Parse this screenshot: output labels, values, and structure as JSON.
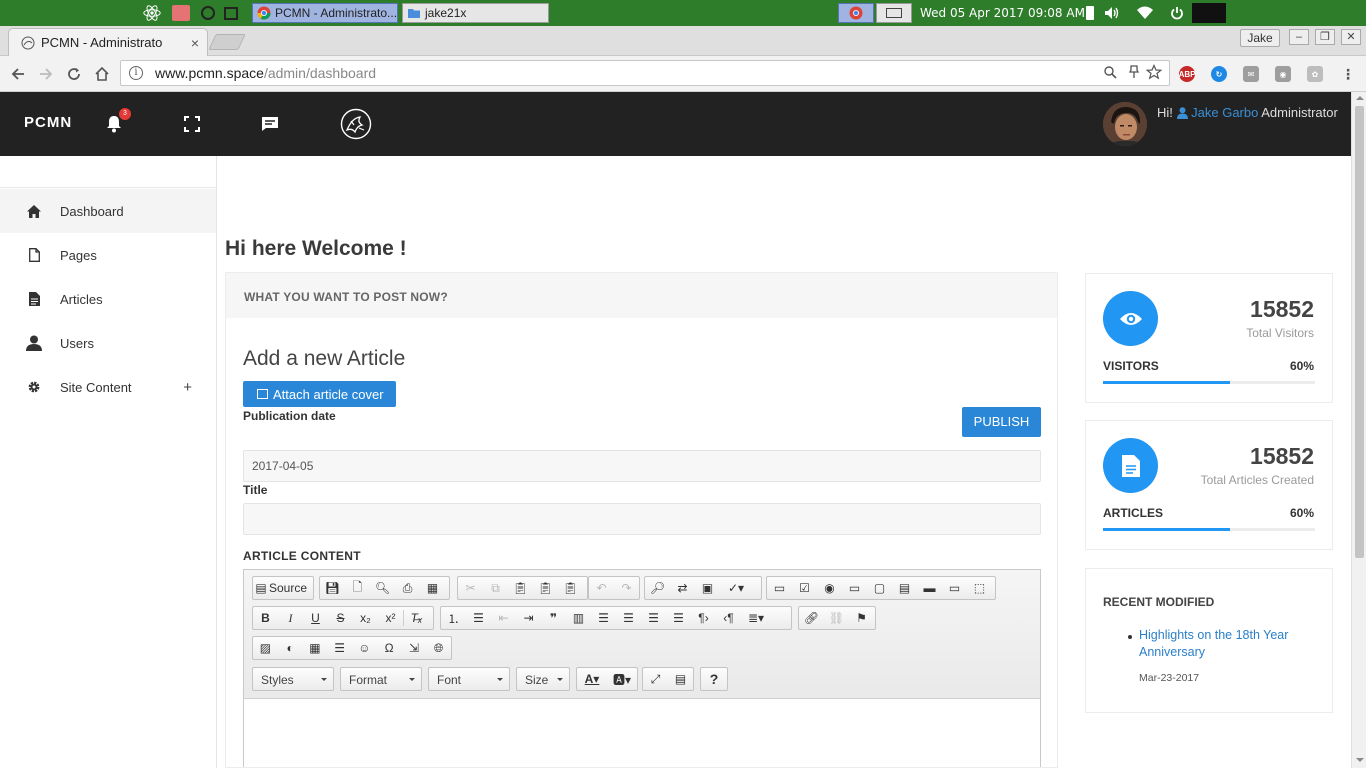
{
  "os": {
    "windows": [
      "PCMN - Administrato...",
      "jake21x"
    ],
    "clock": "Wed 05 Apr 2017  09:08 AM"
  },
  "browser": {
    "tab_title": "PCMN - Administrato",
    "tab_close": "×",
    "profile": "Jake",
    "url_host": "www.pcmn.space",
    "url_path": "/admin/dashboard"
  },
  "navbar": {
    "brand": "PCMN",
    "notification_count": "3",
    "greeting_prefix": "Hi!",
    "user_name": "Jake Garbo",
    "user_role": "Administrator"
  },
  "sidebar": {
    "items": [
      {
        "label": "Dashboard",
        "icon": "home-icon"
      },
      {
        "label": "Pages",
        "icon": "page-icon"
      },
      {
        "label": "Articles",
        "icon": "document-icon"
      },
      {
        "label": "Users",
        "icon": "user-icon"
      },
      {
        "label": "Site Content",
        "icon": "gear-icon",
        "expand": "+"
      }
    ]
  },
  "main": {
    "welcome": "Hi here Welcome !",
    "card_header": "WHAT YOU WANT TO POST NOW?",
    "form_heading": "Add a new Article",
    "attach_button": "Attach article cover",
    "publication_date_label": "Publication date",
    "publish_button": "PUBLISH",
    "publication_date_value": "2017-04-05",
    "title_label": "Title",
    "title_value": "",
    "content_label": "ARTICLE CONTENT"
  },
  "editor": {
    "source_label": "Source",
    "styles": "Styles",
    "format": "Format",
    "font": "Font",
    "size": "Size",
    "help": "?"
  },
  "stats": [
    {
      "value": "15852",
      "caption": "Total Visitors",
      "name": "VISITORS",
      "percent_label": "60%",
      "percent": 60,
      "icon": "eye-icon"
    },
    {
      "value": "15852",
      "caption": "Total Articles Created",
      "name": "ARTICLES",
      "percent_label": "60%",
      "percent": 60,
      "icon": "document-icon"
    }
  ],
  "recent": {
    "title": "RECENT MODIFIED",
    "items": [
      {
        "label": "Highlights on the 18th Year Anniversary",
        "date": "Mar-23-2017"
      }
    ]
  },
  "colors": {
    "accent": "#2a87d8",
    "navbar": "#222222",
    "taskbar": "#2d7d2a",
    "badge": "#e53935"
  }
}
